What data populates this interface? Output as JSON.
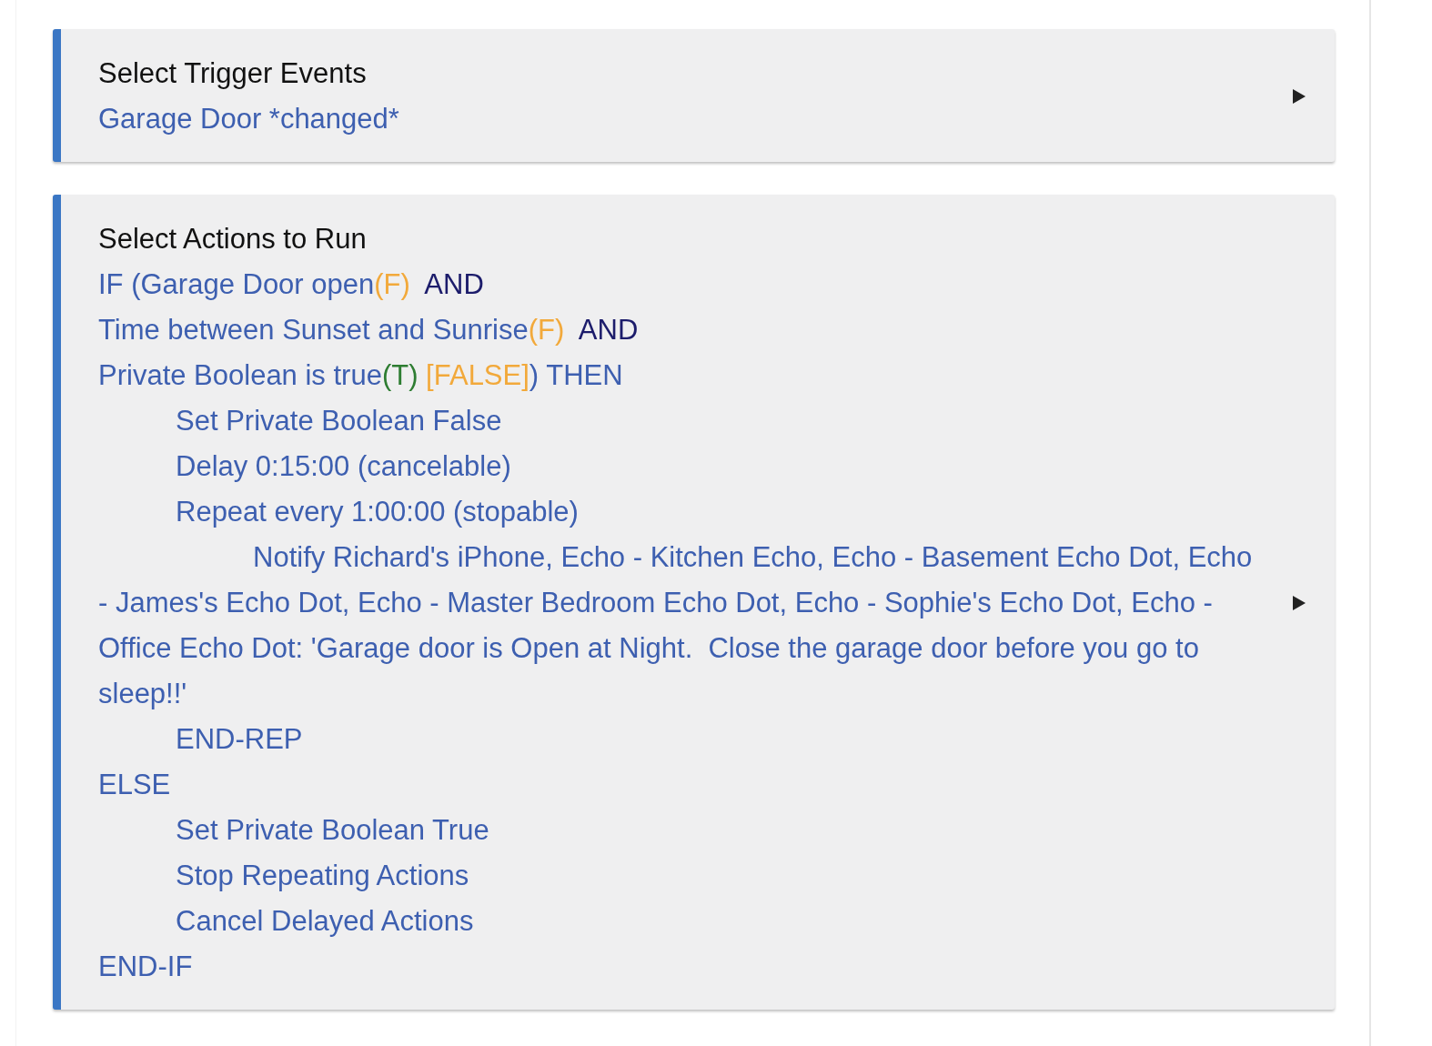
{
  "cards": [
    {
      "title": "Select Trigger Events",
      "lines": [
        {
          "segments": [
            {
              "text": "Garage Door *changed*",
              "color": "#3d5fb0"
            }
          ]
        }
      ]
    },
    {
      "title": "Select Actions to Run",
      "lines": [
        {
          "segments": [
            {
              "text": "IF (Garage Door open",
              "color": "#3d5fb0"
            },
            {
              "text": "(F)",
              "color": "#f2a93b"
            },
            {
              "text": "  AND",
              "color": "#1c1c6b"
            }
          ]
        },
        {
          "segments": [
            {
              "text": "Time between Sunset and Sunrise",
              "color": "#3d5fb0"
            },
            {
              "text": "(F)",
              "color": "#f2a93b"
            },
            {
              "text": "  AND",
              "color": "#1c1c6b"
            }
          ]
        },
        {
          "segments": [
            {
              "text": "Private Boolean is true",
              "color": "#3d5fb0"
            },
            {
              "text": "(T)",
              "color": "#2e7d32"
            },
            {
              "text": " [FALSE]",
              "color": "#f2a93b"
            },
            {
              "text": ") THEN",
              "color": "#3d5fb0"
            }
          ],
          "children": [
            {
              "segments": [
                {
                  "text": "Set Private Boolean False",
                  "color": "#3d5fb0"
                }
              ]
            },
            {
              "segments": [
                {
                  "text": "Delay 0:15:00 (cancelable)",
                  "color": "#3d5fb0"
                }
              ]
            },
            {
              "segments": [
                {
                  "text": "Repeat every 1:00:00 (stopable)",
                  "color": "#3d5fb0"
                }
              ],
              "children": [
                {
                  "segments": [
                    {
                      "text": "Notify Richard's iPhone, Echo - Kitchen Echo, Echo - Basement Echo Dot, Echo - James's Echo Dot, Echo - Master Bedroom Echo Dot, Echo - Sophie's Echo Dot, Echo - Office Echo Dot: 'Garage door is Open at Night.  Close the garage door before you go to sleep!!'",
                      "color": "#3d5fb0"
                    }
                  ]
                }
              ]
            },
            {
              "segments": [
                {
                  "text": "END-REP",
                  "color": "#3d5fb0"
                }
              ]
            }
          ]
        },
        {
          "segments": [
            {
              "text": "ELSE",
              "color": "#3d5fb0"
            }
          ],
          "children": [
            {
              "segments": [
                {
                  "text": "Set Private Boolean True",
                  "color": "#3d5fb0"
                }
              ]
            },
            {
              "segments": [
                {
                  "text": "Stop Repeating Actions",
                  "color": "#3d5fb0"
                }
              ]
            },
            {
              "segments": [
                {
                  "text": "Cancel Delayed Actions",
                  "color": "#3d5fb0"
                }
              ]
            }
          ]
        },
        {
          "segments": [
            {
              "text": "END-IF",
              "color": "#3d5fb0"
            }
          ]
        }
      ]
    }
  ]
}
